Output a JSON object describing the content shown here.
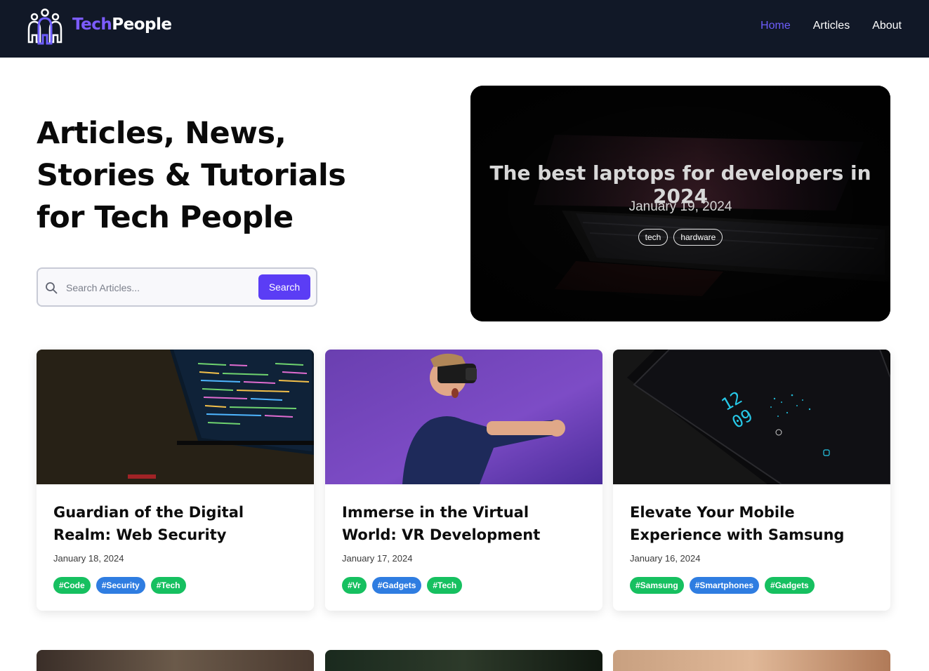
{
  "header": {
    "brand_first": "Tech",
    "brand_second": "People",
    "nav": [
      {
        "label": "Home",
        "active": true
      },
      {
        "label": "Articles",
        "active": false
      },
      {
        "label": "About",
        "active": false
      }
    ],
    "colors": {
      "background": "#111827",
      "accent": "#6d5dfc"
    }
  },
  "hero": {
    "title_lines": [
      "Articles, News,",
      "Stories & Tutorials",
      "for Tech People"
    ],
    "search": {
      "placeholder": "Search Articles...",
      "button": "Search",
      "icon": "search-icon"
    }
  },
  "featured": {
    "title": "The best laptops for developers in 2024",
    "date": "January 19, 2024",
    "tags": [
      "tech",
      "hardware"
    ]
  },
  "cards": [
    {
      "title": "Guardian of the Digital Realm: Web Security",
      "date": "January 18, 2024",
      "tags": [
        {
          "label": "#Code",
          "color": "green"
        },
        {
          "label": "#Security",
          "color": "blue"
        },
        {
          "label": "#Tech",
          "color": "green"
        }
      ]
    },
    {
      "title": "Immerse in the Virtual World: VR Development",
      "date": "January 17, 2024",
      "tags": [
        {
          "label": "#Vr",
          "color": "green"
        },
        {
          "label": "#Gadgets",
          "color": "blue"
        },
        {
          "label": "#Tech",
          "color": "green"
        }
      ]
    },
    {
      "title": "Elevate Your Mobile Experience with Samsung",
      "date": "January 16, 2024",
      "tags": [
        {
          "label": "#Samsung",
          "color": "green"
        },
        {
          "label": "#Smartphones",
          "color": "blue"
        },
        {
          "label": "#Gadgets",
          "color": "green"
        }
      ]
    }
  ],
  "tag_colors": {
    "green": "#16c060",
    "blue": "#2f7de1"
  }
}
